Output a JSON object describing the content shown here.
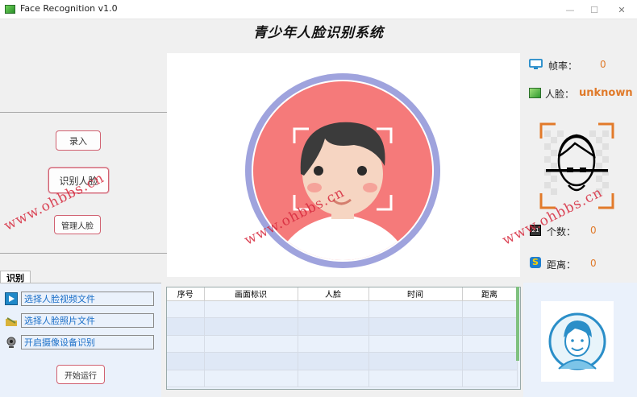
{
  "window": {
    "title": "Face Recognition v1.0",
    "minimize": "—",
    "maximize": "☐",
    "close": "✕"
  },
  "header": {
    "title": "青少年人脸识别系统"
  },
  "left_buttons": {
    "enroll": "录入",
    "recognize": "识别人脸",
    "manage": "管理人脸"
  },
  "stats": {
    "fps_label": "帧率：",
    "fps_value": "0",
    "face_label": "人脸：",
    "face_value": "unknown",
    "count_label": "个数：",
    "count_value": "0",
    "distance_label": "距离：",
    "distance_value": "0"
  },
  "tab": {
    "label": "识别",
    "sources": [
      "选择人脸视频文件",
      "选择人脸照片文件",
      "开启摄像设备识别"
    ],
    "run_button": "开始运行"
  },
  "table": {
    "columns": [
      "序号",
      "画面标识",
      "人脸",
      "时间",
      "距离"
    ],
    "rows": [
      [
        "",
        "",
        "",
        "",
        ""
      ],
      [
        "",
        "",
        "",
        "",
        ""
      ],
      [
        "",
        "",
        "",
        "",
        ""
      ],
      [
        "",
        "",
        "",
        "",
        ""
      ],
      [
        "",
        "",
        "",
        "",
        ""
      ]
    ]
  },
  "watermark": {
    "text": "www.ohbbs.cn"
  },
  "colors": {
    "accent_orange": "#e07a2a",
    "button_border": "#d06070",
    "source_text": "#1b6fc8",
    "face_circle": "#f57a7a",
    "face_ring": "#9fa3dd"
  }
}
